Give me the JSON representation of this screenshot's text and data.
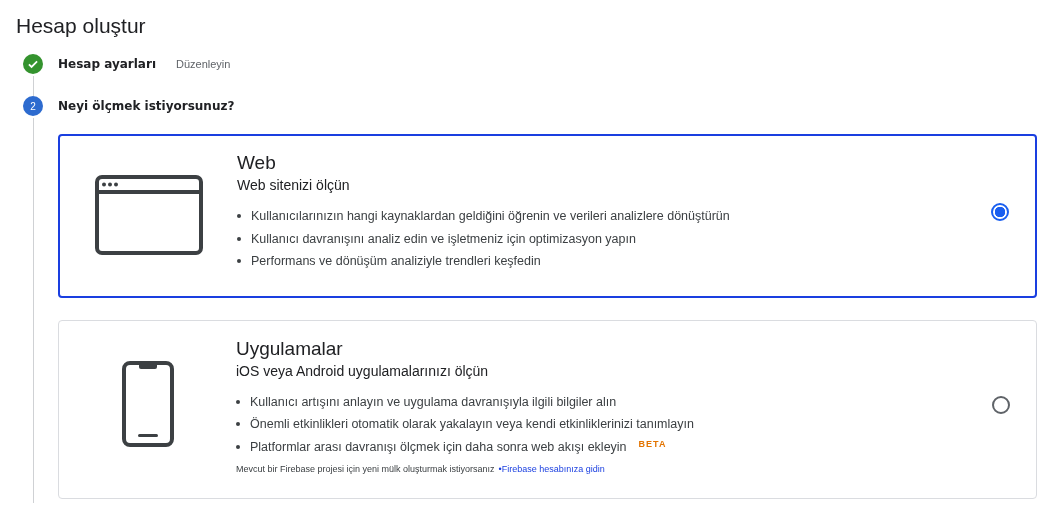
{
  "title": "Hesap oluştur",
  "steps": [
    {
      "kind": "done",
      "label": "Hesap ayarları",
      "action": "Düzenleyin"
    },
    {
      "kind": "current",
      "number": "2",
      "label": "Neyi ölçmek istiyorsunuz?"
    }
  ],
  "options": [
    {
      "kind": "web",
      "title": "Web",
      "subtitle": "Web sitenizi ölçün",
      "selected": true,
      "bullets": [
        {
          "text": "Kullanıcılarınızın hangi kaynaklardan geldiğini öğrenin ve verileri analizlere dönüştürün"
        },
        {
          "text": "Kullanıcı davranışını analiz edin ve işletmeniz için optimizasyon yapın"
        },
        {
          "text": "Performans ve dönüşüm analiziyle trendleri keşfedin"
        }
      ]
    },
    {
      "kind": "app",
      "title": "Uygulamalar",
      "subtitle": "iOS veya Android uygulamalarınızı ölçün",
      "selected": false,
      "bullets": [
        {
          "text": "Kullanıcı artışını anlayın ve uygulama davranışıyla ilgili bilgiler alın"
        },
        {
          "text": "Önemli etkinlikleri otomatik olarak yakalayın veya kendi etkinliklerinizi tanımlayın"
        },
        {
          "text": "Platformlar arası davranışı ölçmek için daha sonra web akışı ekleyin",
          "badge": "BETA"
        }
      ],
      "note": "Mevcut bir Firebase projesi için yeni mülk oluşturmak istiyorsanız",
      "link": "•Firebase hesabınıza gidin"
    }
  ]
}
